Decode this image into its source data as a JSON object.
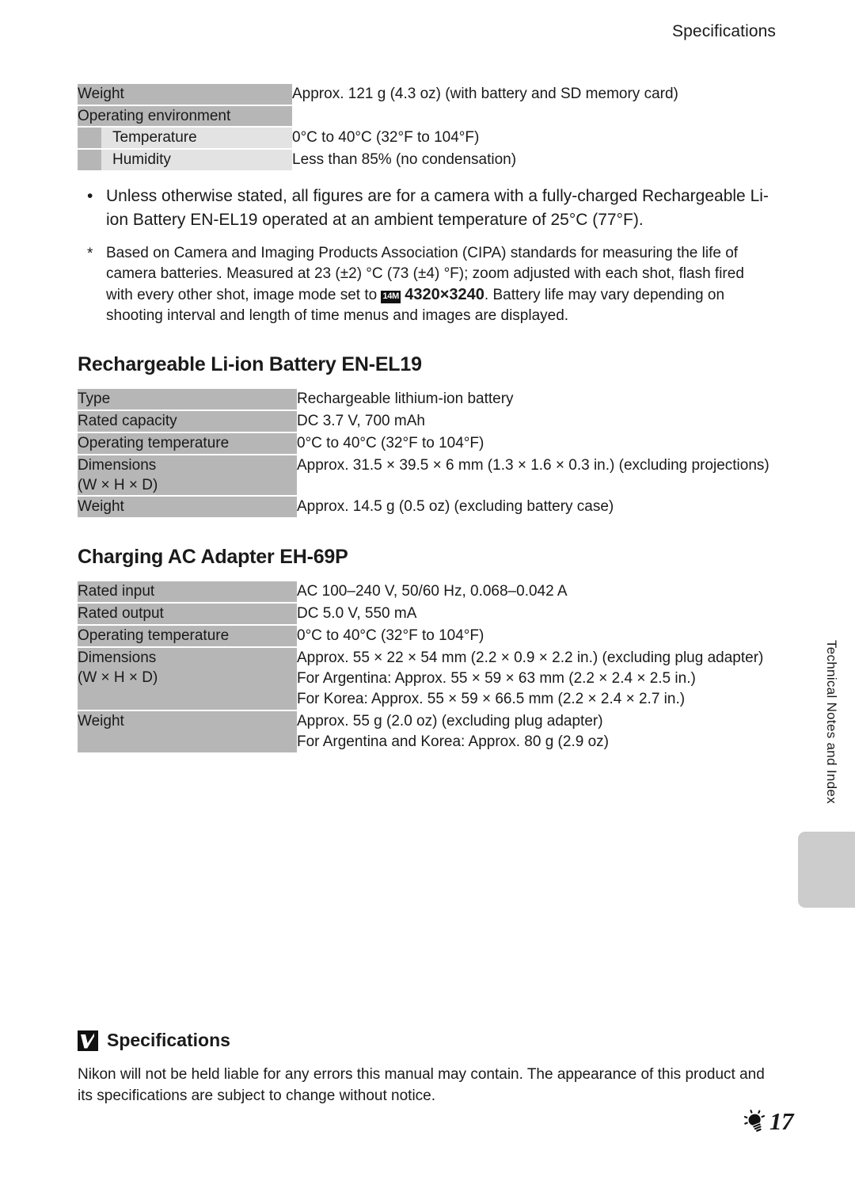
{
  "header": {
    "running_title": "Specifications"
  },
  "camera_table": {
    "rows": [
      {
        "label": "Weight",
        "value": "Approx. 121 g (4.3 oz) (with battery and SD memory card)",
        "sub": false
      },
      {
        "label": "Operating environment",
        "value": "",
        "sub": false
      },
      {
        "label": "Temperature",
        "value": "0°C to 40°C (32°F to 104°F)",
        "sub": true
      },
      {
        "label": "Humidity",
        "value": "Less than 85% (no condensation)",
        "sub": true
      }
    ]
  },
  "bullet": {
    "mark": "•",
    "text": "Unless otherwise stated, all figures are for a camera with a fully-charged Rechargeable Li-ion Battery EN-EL19 operated at an ambient temperature of 25°C (77°F)."
  },
  "footnote": {
    "mark": "*",
    "part1": "Based on Camera and Imaging Products Association (CIPA) standards for measuring the life of camera batteries. Measured at 23 (±2) °C (73 (±4) °F); zoom adjusted with each shot, flash fired with every other shot, image mode set to",
    "badge": "14M",
    "mode": "4320×3240",
    "part2": ". Battery life may vary depending on shooting interval and length of time menus and images are displayed."
  },
  "battery_section": {
    "heading": "Rechargeable Li-ion Battery EN-EL19",
    "rows": [
      {
        "label": "Type",
        "value": "Rechargeable lithium-ion battery"
      },
      {
        "label": "Rated capacity",
        "value": "DC 3.7 V, 700 mAh"
      },
      {
        "label": "Operating temperature",
        "value": "0°C to 40°C (32°F to 104°F)"
      },
      {
        "label": "Dimensions\n(W × H × D)",
        "value": "Approx. 31.5 × 39.5 × 6 mm (1.3 × 1.6 × 0.3 in.) (excluding projections)"
      },
      {
        "label": "Weight",
        "value": "Approx. 14.5 g (0.5 oz) (excluding battery case)"
      }
    ]
  },
  "adapter_section": {
    "heading": "Charging AC Adapter EH-69P",
    "rows": [
      {
        "label": "Rated input",
        "value": "AC 100–240 V, 50/60 Hz, 0.068–0.042 A"
      },
      {
        "label": "Rated output",
        "value": "DC 5.0 V, 550 mA"
      },
      {
        "label": "Operating temperature",
        "value": "0°C to 40°C (32°F to 104°F)"
      },
      {
        "label": "Dimensions\n(W × H × D)",
        "value": "Approx. 55 × 22 × 54 mm (2.2 × 0.9 × 2.2 in.) (excluding plug adapter)\nFor Argentina: Approx. 55 × 59 × 63 mm (2.2 × 2.4 × 2.5 in.)\nFor Korea: Approx. 55 × 59 × 66.5 mm (2.2 × 2.4 × 2.7 in.)"
      },
      {
        "label": "Weight",
        "value": "Approx. 55 g (2.0 oz) (excluding plug adapter)\nFor Argentina and Korea: Approx. 80 g (2.9 oz)"
      }
    ]
  },
  "note": {
    "title": "Specifications",
    "body": "Nikon will not be held liable for any errors this manual may contain. The appearance of this product and its specifications are subject to change without notice."
  },
  "side_tab": {
    "label": "Technical Notes and Index"
  },
  "footer": {
    "page_number": "17"
  },
  "colors": {
    "label_gray": "#b6b6b6",
    "sub_label_gray": "#e3e3e3",
    "tab_gray": "#cccccc",
    "text": "#1a1a1a"
  }
}
